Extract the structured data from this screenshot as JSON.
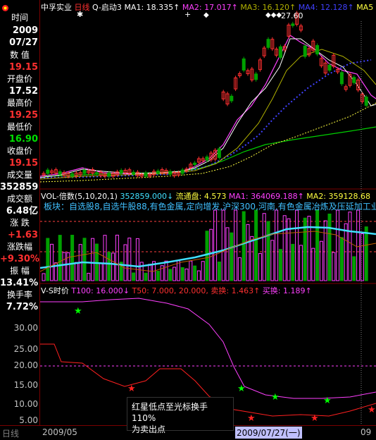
{
  "colors": {
    "up": "#ff3030",
    "down": "#00a000",
    "ma1": "#ffffff",
    "ma2": "#ff40ff",
    "ma3": "#b0b000",
    "ma4": "#4040ff",
    "ma5": "#ffff40",
    "vol_ma": "#40e0ff",
    "title_red": "#ff3030"
  },
  "side": {
    "logo_icon": "lotus-logo-icon",
    "time_label": "时间",
    "date_year": "2009",
    "date_md": "07/27",
    "value_label": "数 值",
    "value": "19.15",
    "open_label": "开盘价",
    "open": "17.52",
    "high_label": "最高价",
    "high": "19.25",
    "low_label": "最低价",
    "low": "16.90",
    "close_label": "收盘价",
    "close": "19.15",
    "vol_label": "成交量",
    "vol": "352859",
    "amount_label": "成交额",
    "amount": "6.48亿",
    "change_label": "涨 跌",
    "change": "+1.63",
    "pct_label": "涨跌幅",
    "pct": "+9.30%",
    "amp_label": "振 幅",
    "amp": "13.41%",
    "turnover_label": "换手率",
    "turnover": "7.72%"
  },
  "header": {
    "name": "中孚实业",
    "period": "日线",
    "formula": "Q-启动3",
    "ma1": "MA1: 18.335↑",
    "ma2": "MA2: 17.017↑",
    "ma3": "MA3: 16.120↑",
    "ma4": "MA4: 12.128↑",
    "ma5": "MA5",
    "peak": "27.60"
  },
  "vol_panel": {
    "title": "VOL-倍数(5,10,20,1)",
    "vol": "352859.000↓",
    "float": "流通盘: 4.573",
    "ma1": "MA1: 364069.188↑",
    "ma2": "MA2: 359128.68",
    "board": "板块：自选股8,自选牛股88,有色金属,定向增发,沪深300,河南,有色金属冶炼及压延加工业"
  },
  "vs_panel": {
    "title": "V-S时价",
    "t100": "T100: 16.000↓",
    "t50": "T50: 7.000,",
    "t20": "20.000,",
    "sell": "卖换: 1.463↑",
    "buy": "买换: 1.189↑",
    "ticks": [
      "30.00",
      "25.00",
      "20.00",
      "15.00",
      "10.00",
      "5.00"
    ]
  },
  "tooltip": {
    "line1": "红星低点至光标换手110%",
    "line2": "为卖出点"
  },
  "bottom": {
    "tab": "日线",
    "date_left": "2009/05",
    "date_cursor": "2009/07/27(一)",
    "date_right": "09"
  }
}
